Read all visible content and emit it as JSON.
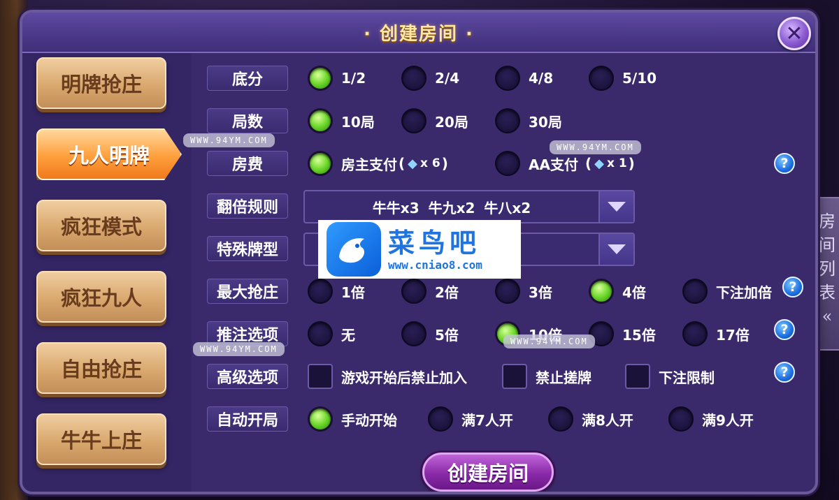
{
  "dialog": {
    "title": "· 创建房间 ·",
    "close_label": "✕"
  },
  "side_modes": [
    {
      "label": "明牌抢庄",
      "active": false
    },
    {
      "label": "九人明牌",
      "active": true
    },
    {
      "label": "疯狂模式",
      "active": false
    },
    {
      "label": "疯狂九人",
      "active": false
    },
    {
      "label": "自由抢庄",
      "active": false
    },
    {
      "label": "牛牛上庄",
      "active": false
    }
  ],
  "rows": {
    "base_score": {
      "label": "底分",
      "options": [
        "1/2",
        "2/4",
        "4/8",
        "5/10"
      ],
      "selected": "1/2"
    },
    "rounds": {
      "label": "局数",
      "options": [
        "10局",
        "20局",
        "30局"
      ],
      "selected": "10局"
    },
    "fee": {
      "label": "房费",
      "options": [
        {
          "text": "房主支付",
          "cost_prefix": "(",
          "cost": "x 6",
          "cost_suffix": ")"
        },
        {
          "text": "AA支付",
          "cost_prefix": "(",
          "cost": "x 1",
          "cost_suffix": ")"
        }
      ],
      "selected": "房主支付"
    },
    "double_rule": {
      "label": "翻倍规则",
      "value": "牛牛x3 牛九x2 牛八x2"
    },
    "special_cards": {
      "label": "特殊牌型",
      "value": ""
    },
    "max_grab": {
      "label": "最大抢庄",
      "options": [
        "1倍",
        "2倍",
        "3倍",
        "4倍",
        "下注加倍"
      ],
      "selected": "4倍"
    },
    "push_bet": {
      "label": "推注选项",
      "options": [
        "无",
        "5倍",
        "10倍",
        "15倍",
        "17倍"
      ],
      "selected": "10倍"
    },
    "advanced": {
      "label": "高级选项",
      "options": [
        "游戏开始后禁止加入",
        "禁止搓牌",
        "下注限制"
      ]
    },
    "auto_start": {
      "label": "自动开局",
      "options": [
        "手动开始",
        "满7人开",
        "满8人开",
        "满9人开"
      ],
      "selected": "手动开始"
    }
  },
  "create_button": "创建房间",
  "right_tab": [
    "房",
    "间",
    "列",
    "表",
    "«"
  ],
  "watermarks": {
    "site": "WWW.94YM.COM"
  },
  "logo": {
    "name": "菜鸟吧",
    "url": "www.cniao8.com"
  },
  "colors": {
    "selected_radio": "#6cd82a",
    "panel": "#3b2a6b",
    "active_tab": "#ff9f3c",
    "create_button": "#8a2aa8"
  }
}
